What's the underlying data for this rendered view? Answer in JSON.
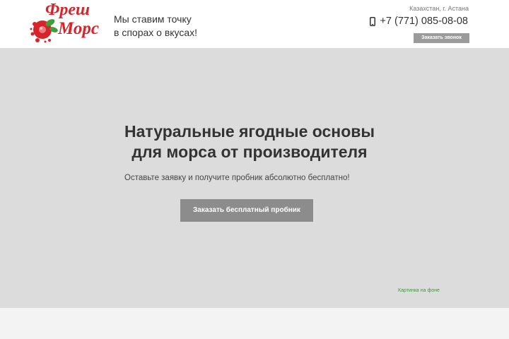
{
  "header": {
    "logo": {
      "line1": "Фреш",
      "line2": "Морс",
      "colors": {
        "brand_red": "#d8232a",
        "leaf_green": "#3f9d3a"
      }
    },
    "slogan": {
      "line1": "Мы ставим точку",
      "line2": "в спорах о вкусах!"
    },
    "location": "Казахстан, г. Астана",
    "phone": "+7 (771) 085-08-08",
    "phone_icon": "mobile-phone-icon",
    "callback_label": "Заказать звонок"
  },
  "hero": {
    "background": "#dcdcdc",
    "title_line1": "Натуральные ягодные основы",
    "title_line2": "для морса от производителя",
    "subtitle": "Оставьте заявку и получите пробник абсолютно бесплатно!",
    "cta_label": "Заказать бесплатный пробник",
    "image_note": "Картинка на фоне"
  }
}
